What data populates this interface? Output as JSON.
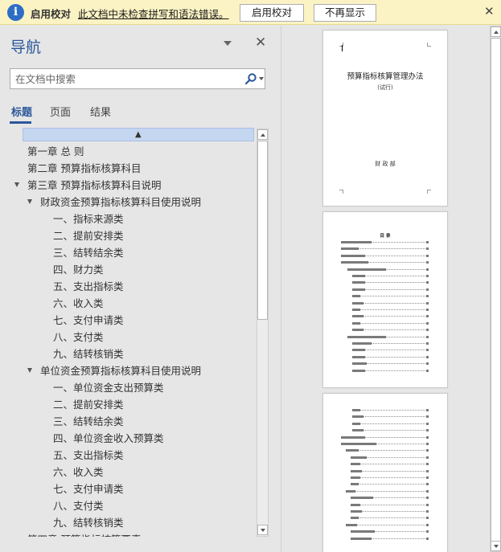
{
  "infobar": {
    "title": "启用校对",
    "message": "此文档中未检查拼写和语法错误。",
    "enable_button": "启用校对",
    "dismiss_button": "不再显示"
  },
  "nav": {
    "title": "导航",
    "search_placeholder": "在文档中搜索",
    "tabs": [
      "标题",
      "页面",
      "结果"
    ],
    "headings": [
      {
        "text": "第一章  总  则",
        "level": 1,
        "expanded": false
      },
      {
        "text": "第二章 预算指标核算科目",
        "level": 1,
        "expanded": false
      },
      {
        "text": "第三章 预算指标核算科目说明",
        "level": 1,
        "expanded": true
      },
      {
        "text": "财政资金预算指标核算科目使用说明",
        "level": 2,
        "expanded": true
      },
      {
        "text": "一、指标来源类",
        "level": 3,
        "expanded": false
      },
      {
        "text": "二、提前安排类",
        "level": 3,
        "expanded": false
      },
      {
        "text": "三、结转结余类",
        "level": 3,
        "expanded": false
      },
      {
        "text": "四、财力类",
        "level": 3,
        "expanded": false
      },
      {
        "text": "五、支出指标类",
        "level": 3,
        "expanded": false
      },
      {
        "text": "六、收入类",
        "level": 3,
        "expanded": false
      },
      {
        "text": "七、支付申请类",
        "level": 3,
        "expanded": false
      },
      {
        "text": "八、支付类",
        "level": 3,
        "expanded": false
      },
      {
        "text": "九、结转核销类",
        "level": 3,
        "expanded": false
      },
      {
        "text": "单位资金预算指标核算科目使用说明",
        "level": 2,
        "expanded": true
      },
      {
        "text": "一、单位资金支出预算类",
        "level": 3,
        "expanded": false
      },
      {
        "text": "二、提前安排类",
        "level": 3,
        "expanded": false
      },
      {
        "text": "三、结转结余类",
        "level": 3,
        "expanded": false
      },
      {
        "text": "四、单位资金收入预算类",
        "level": 3,
        "expanded": false
      },
      {
        "text": "五、支出指标类",
        "level": 3,
        "expanded": false
      },
      {
        "text": "六、收入类",
        "level": 3,
        "expanded": false
      },
      {
        "text": "七、支付申请类",
        "level": 3,
        "expanded": false
      },
      {
        "text": "八、支付类",
        "level": 3,
        "expanded": false
      },
      {
        "text": "九、结转核销类",
        "level": 3,
        "expanded": false
      },
      {
        "text": "第四章 预算指标核算要素",
        "level": 1,
        "expanded": false
      }
    ]
  },
  "pages": {
    "page1": {
      "title": "预算指标核算管理办法",
      "subtitle": "(试行)",
      "footer": "财 政 部"
    },
    "page2": {
      "heading": "目    录"
    }
  },
  "colors": {
    "accent": "#2b579a",
    "infobar_bg": "#fcf3c4",
    "selection": "#c5d6f0"
  }
}
